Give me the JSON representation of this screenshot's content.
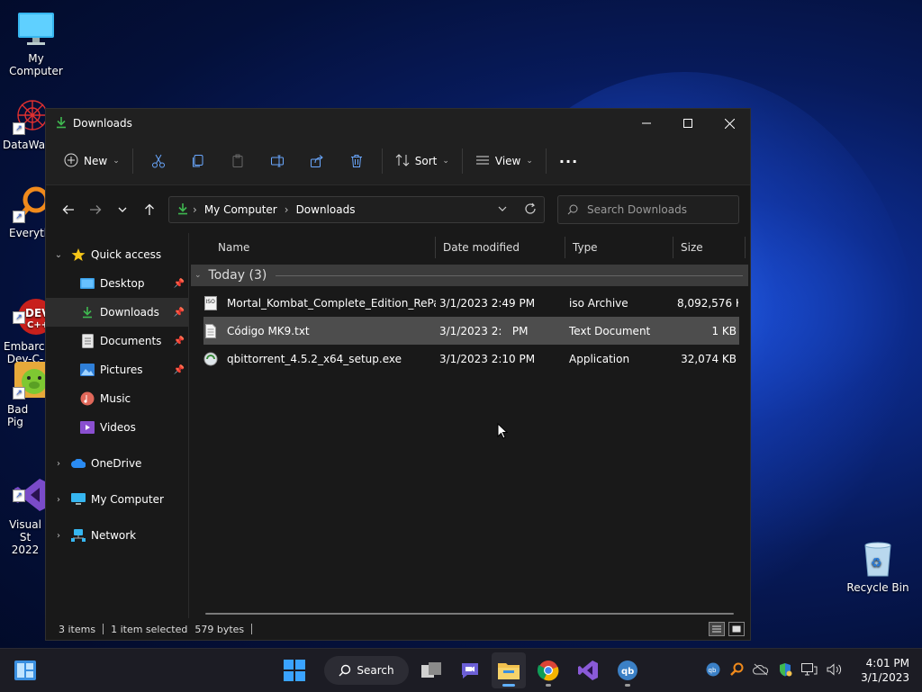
{
  "desktop": {
    "icons": [
      {
        "label": "My Computer",
        "name": "my-computer-desktop-icon"
      },
      {
        "label": "DataWag",
        "name": "datawag-desktop-icon"
      },
      {
        "label": "Everyth",
        "name": "everything-desktop-icon"
      },
      {
        "label": "Embarca\nDev-C-",
        "name": "dev-cpp-desktop-icon"
      },
      {
        "label": "Bad Pig",
        "name": "bad-piggies-desktop-icon"
      },
      {
        "label": "Visual St\n2022",
        "name": "visual-studio-desktop-icon"
      }
    ],
    "recycle_bin": "Recycle Bin"
  },
  "window": {
    "title": "Downloads",
    "icon": "download-arrow-icon"
  },
  "command_bar": {
    "new_label": "New",
    "sort_label": "Sort",
    "view_label": "View",
    "more_label": "···"
  },
  "address": {
    "crumbs": [
      "My Computer",
      "Downloads"
    ],
    "search_placeholder": "Search Downloads"
  },
  "nav": {
    "quick_access": "Quick access",
    "items": [
      {
        "label": "Desktop",
        "pinned": true
      },
      {
        "label": "Downloads",
        "pinned": true,
        "selected": true
      },
      {
        "label": "Documents",
        "pinned": true
      },
      {
        "label": "Pictures",
        "pinned": true
      },
      {
        "label": "Music",
        "pinned": false
      },
      {
        "label": "Videos",
        "pinned": false
      }
    ],
    "onedrive": "OneDrive",
    "my_computer": "My Computer",
    "network": "Network"
  },
  "columns": {
    "name": "Name",
    "date": "Date modified",
    "type": "Type",
    "size": "Size"
  },
  "group": {
    "label": "Today (3)"
  },
  "files": [
    {
      "name": "Mortal_Kombat_Complete_Edition_RePa...",
      "date": "3/1/2023 2:49 PM",
      "type": "iso Archive",
      "size": "8,092,576 KB",
      "icon": "iso-file-icon"
    },
    {
      "name": "Código MK9.txt",
      "date": "3/1/2023 2:   PM",
      "type": "Text Document",
      "size": "1 KB",
      "icon": "text-file-icon"
    },
    {
      "name": "qbittorrent_4.5.2_x64_setup.exe",
      "date": "3/1/2023 2:10 PM",
      "type": "Application",
      "size": "32,074 KB",
      "icon": "installer-icon"
    }
  ],
  "status": {
    "items": "3 items",
    "selected": "1 item selected",
    "bytes": "579 bytes"
  },
  "taskbar": {
    "search_label": "Search",
    "clock_time": "4:01 PM",
    "clock_date": "3/1/2023"
  },
  "colors": {
    "accent": "#2a7ad6",
    "download_green": "#3fb950",
    "folder_yellow": "#f2c14e"
  }
}
